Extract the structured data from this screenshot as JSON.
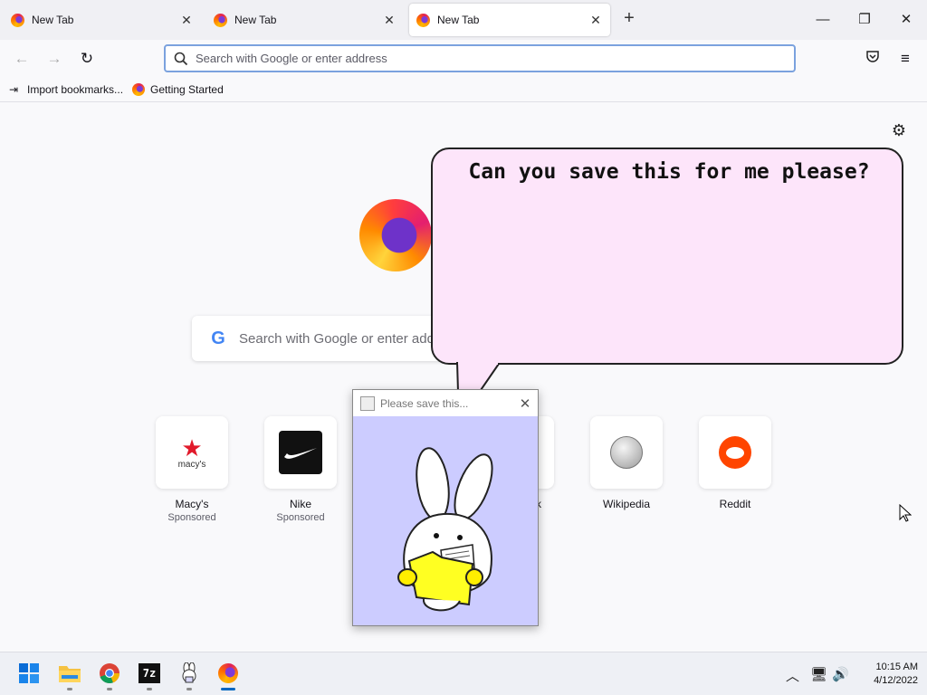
{
  "tabs": [
    {
      "label": "New Tab",
      "active": false
    },
    {
      "label": "New Tab",
      "active": false
    },
    {
      "label": "New Tab",
      "active": true
    }
  ],
  "navbar": {
    "url_placeholder": "Search with Google or enter address",
    "url_value": ""
  },
  "bookmarks": [
    {
      "label": "Import bookmarks...",
      "icon": "import-icon"
    },
    {
      "label": "Getting Started",
      "icon": "firefox-icon"
    }
  ],
  "newtab": {
    "search_placeholder": "Search with Google or enter address",
    "top_sites": [
      {
        "name": "Macy's",
        "sub": "Sponsored",
        "logo_text": "macy's"
      },
      {
        "name": "Nike",
        "sub": "Sponsored"
      },
      {
        "name": "Wikipedia",
        "sub": ""
      },
      {
        "name": "Reddit",
        "sub": ""
      }
    ],
    "partial_site_label": "k"
  },
  "bubble": {
    "text": "Can you save this for me please?",
    "background": "#fde5fa"
  },
  "popup": {
    "title": "Please save this..."
  },
  "taskbar": {
    "apps": [
      "windows-start-icon",
      "file-explorer-icon",
      "chrome-icon",
      "7zip-icon",
      "bunny-app-icon",
      "firefox-icon"
    ],
    "sevenzip_label": "7z",
    "time": "10:15 AM",
    "date": "4/12/2022"
  }
}
